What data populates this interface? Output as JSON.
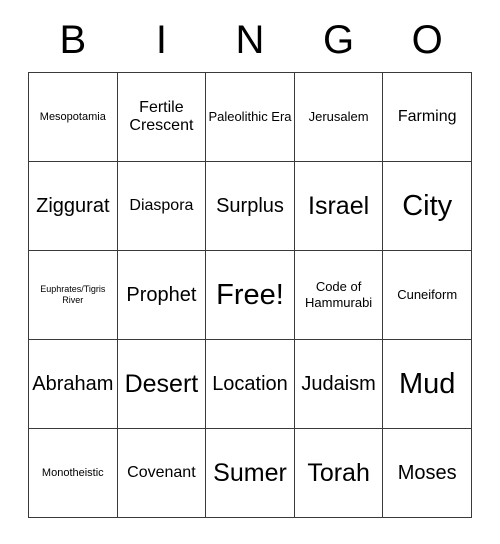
{
  "card": {
    "title": "BINGO Card",
    "header_letters": [
      "B",
      "I",
      "N",
      "G",
      "O"
    ],
    "columns": 5,
    "rows": 5,
    "border_color": "#3a3a3a",
    "background_color": "#ffffff",
    "text_color": "#000000",
    "free_space": "Free!",
    "free_space_position": {
      "row": 3,
      "column": 3
    },
    "cells": [
      [
        {
          "text": "Mesopotamia",
          "size": "sm"
        },
        {
          "text": "Fertile Crescent",
          "size": "lg"
        },
        {
          "text": "Paleolithic Era",
          "size": "md"
        },
        {
          "text": "Jerusalem",
          "size": "md"
        },
        {
          "text": "Farming",
          "size": "lg"
        }
      ],
      [
        {
          "text": "Ziggurat",
          "size": "xl"
        },
        {
          "text": "Diaspora",
          "size": "lg"
        },
        {
          "text": "Surplus",
          "size": "xl"
        },
        {
          "text": "Israel",
          "size": "xxl"
        },
        {
          "text": "City",
          "size": "huge"
        }
      ],
      [
        {
          "text": "Euphrates/Tigris River",
          "size": "xs"
        },
        {
          "text": "Prophet",
          "size": "xl"
        },
        {
          "text": "Free!",
          "size": "huge"
        },
        {
          "text": "Code of Hammurabi",
          "size": "md"
        },
        {
          "text": "Cuneiform",
          "size": "md"
        }
      ],
      [
        {
          "text": "Abraham",
          "size": "xl"
        },
        {
          "text": "Desert",
          "size": "xxl"
        },
        {
          "text": "Location",
          "size": "xl"
        },
        {
          "text": "Judaism",
          "size": "xl"
        },
        {
          "text": "Mud",
          "size": "huge"
        }
      ],
      [
        {
          "text": "Monotheistic",
          "size": "sm"
        },
        {
          "text": "Covenant",
          "size": "lg"
        },
        {
          "text": "Sumer",
          "size": "xxl"
        },
        {
          "text": "Torah",
          "size": "xxl"
        },
        {
          "text": "Moses",
          "size": "xl"
        }
      ]
    ]
  }
}
